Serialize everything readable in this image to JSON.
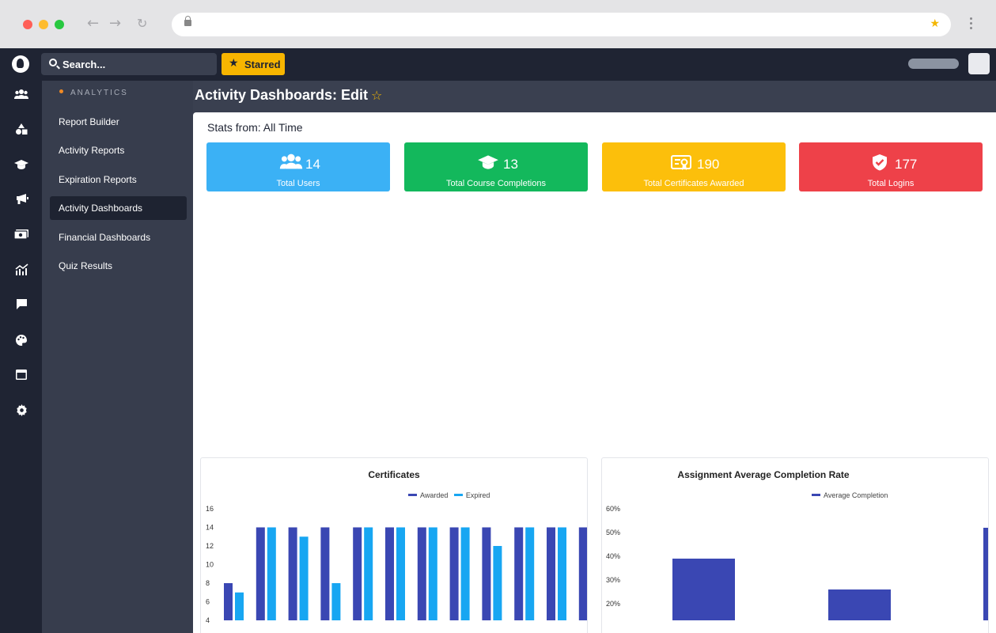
{
  "browser": {
    "back_icon": "arrow-left-icon",
    "forward_icon": "arrow-right-icon",
    "reload_icon": "reload-icon"
  },
  "topbar": {
    "search_placeholder": "Search...",
    "starred_label": "Starred"
  },
  "rail": {
    "icons": [
      "users-icon",
      "shapes-icon",
      "graduation-cap-icon",
      "megaphone-icon",
      "money-icon",
      "chart-line-icon",
      "comment-icon",
      "palette-icon",
      "window-icon",
      "gear-icon"
    ]
  },
  "sidebar": {
    "section": "ANALYTICS",
    "items": [
      {
        "label": "Report Builder"
      },
      {
        "label": "Activity Reports"
      },
      {
        "label": "Expiration Reports"
      },
      {
        "label": "Activity Dashboards",
        "active": true
      },
      {
        "label": "Financial Dashboards"
      },
      {
        "label": "Quiz Results"
      }
    ]
  },
  "page": {
    "title": "Activity Dashboards: Edit",
    "stats_from": "Stats from: All Time"
  },
  "cards": [
    {
      "value": "14",
      "label": "Total Users",
      "icon": "users-icon",
      "color": "#3bb1f5"
    },
    {
      "value": "13",
      "label": "Total Course Completions",
      "icon": "graduation-cap-icon",
      "color": "#13b85c"
    },
    {
      "value": "190",
      "label": "Total Certificates Awarded",
      "icon": "certificate-icon",
      "color": "#fcbf0b"
    },
    {
      "value": "177",
      "label": "Total Logins",
      "icon": "shield-check-icon",
      "color": "#ee4149"
    }
  ],
  "chart_data": [
    {
      "type": "bar",
      "title": "Certificates",
      "legend_position": "top",
      "y_ticks": [
        "16",
        "14",
        "12",
        "10",
        "8",
        "6",
        "4"
      ],
      "ylim": [
        4,
        16
      ],
      "series": [
        {
          "name": "Awarded",
          "color": "#3a47b3",
          "values": [
            8,
            14,
            14,
            14,
            14,
            14,
            14,
            14,
            14,
            14,
            14,
            14
          ]
        },
        {
          "name": "Expired",
          "color": "#17a6f2",
          "values": [
            7,
            14,
            13,
            8,
            14,
            14,
            14,
            14,
            12,
            14,
            14,
            null
          ]
        }
      ]
    },
    {
      "type": "bar",
      "title": "Assignment Average Completion Rate",
      "legend_position": "top",
      "y_ticks": [
        "60%",
        "50%",
        "40%",
        "30%",
        "20%"
      ],
      "ylim": [
        20,
        60
      ],
      "series": [
        {
          "name": "Average Completion",
          "color": "#3a47b3",
          "values": [
            39,
            26,
            52
          ]
        }
      ]
    }
  ]
}
